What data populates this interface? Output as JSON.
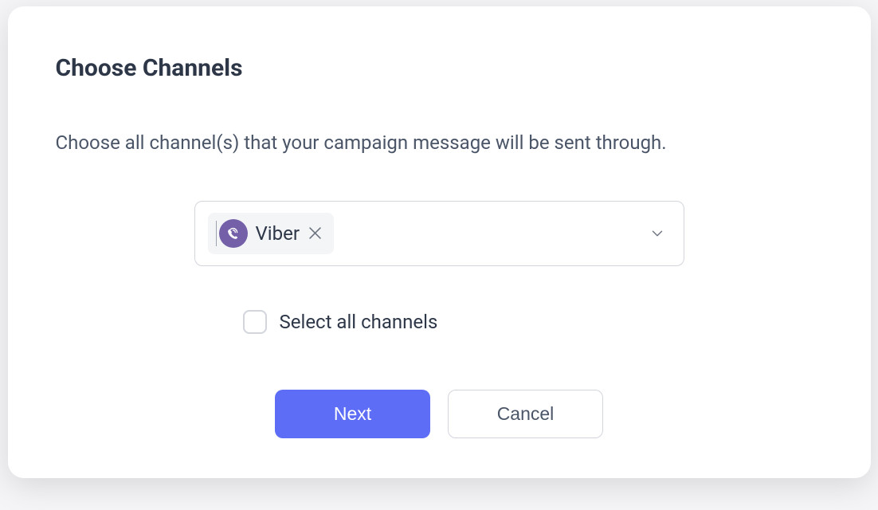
{
  "title": "Choose Channels",
  "description": "Choose all channel(s) that your campaign message will be sent through.",
  "select": {
    "chip": {
      "icon": "viber",
      "label": "Viber"
    }
  },
  "checkbox": {
    "label": "Select all channels",
    "checked": false
  },
  "buttons": {
    "primary": "Next",
    "secondary": "Cancel"
  },
  "colors": {
    "primary": "#5d6df6",
    "viber": "#7360a8",
    "text": "#2d3748",
    "subtext": "#4a5568"
  }
}
